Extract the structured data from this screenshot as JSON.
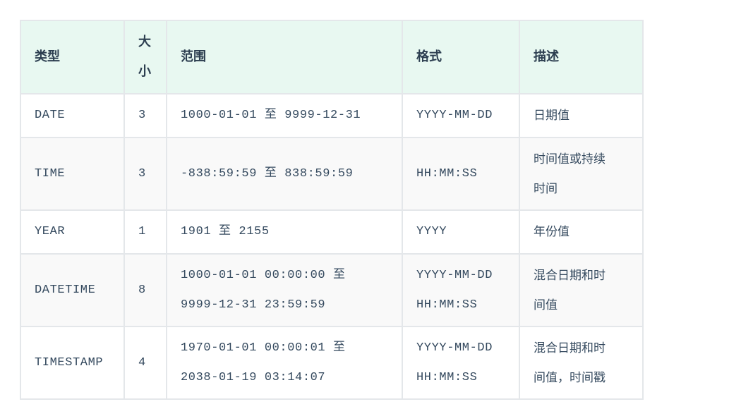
{
  "headers": {
    "type": "类型",
    "size_line1": "大",
    "size_line2": "小",
    "range": "范围",
    "format": "格式",
    "desc": "描述"
  },
  "rows": [
    {
      "type": "DATE",
      "size": "3",
      "range_line1": "1000-01-01 至 9999-12-31",
      "range_line2": "",
      "format_line1": "YYYY-MM-DD",
      "format_line2": "",
      "desc_line1": "日期值",
      "desc_line2": ""
    },
    {
      "type": "TIME",
      "size": "3",
      "range_line1": "-838:59:59 至 838:59:59",
      "range_line2": "",
      "format_line1": "HH:MM:SS",
      "format_line2": "",
      "desc_line1": "时间值或持续",
      "desc_line2": "时间"
    },
    {
      "type": "YEAR",
      "size": "1",
      "range_line1": "1901 至 2155",
      "range_line2": "",
      "format_line1": "YYYY",
      "format_line2": "",
      "desc_line1": "年份值",
      "desc_line2": ""
    },
    {
      "type": "DATETIME",
      "size": "8",
      "range_line1": "1000-01-01 00:00:00 至",
      "range_line2": "9999-12-31 23:59:59",
      "format_line1": "YYYY-MM-DD",
      "format_line2": "HH:MM:SS",
      "desc_line1": "混合日期和时",
      "desc_line2": "间值"
    },
    {
      "type": "TIMESTAMP",
      "size": "4",
      "range_line1": "1970-01-01 00:00:01 至",
      "range_line2": "2038-01-19 03:14:07",
      "format_line1": "YYYY-MM-DD",
      "format_line2": "HH:MM:SS",
      "desc_line1": "混合日期和时",
      "desc_line2": "间值，时间戳"
    }
  ]
}
